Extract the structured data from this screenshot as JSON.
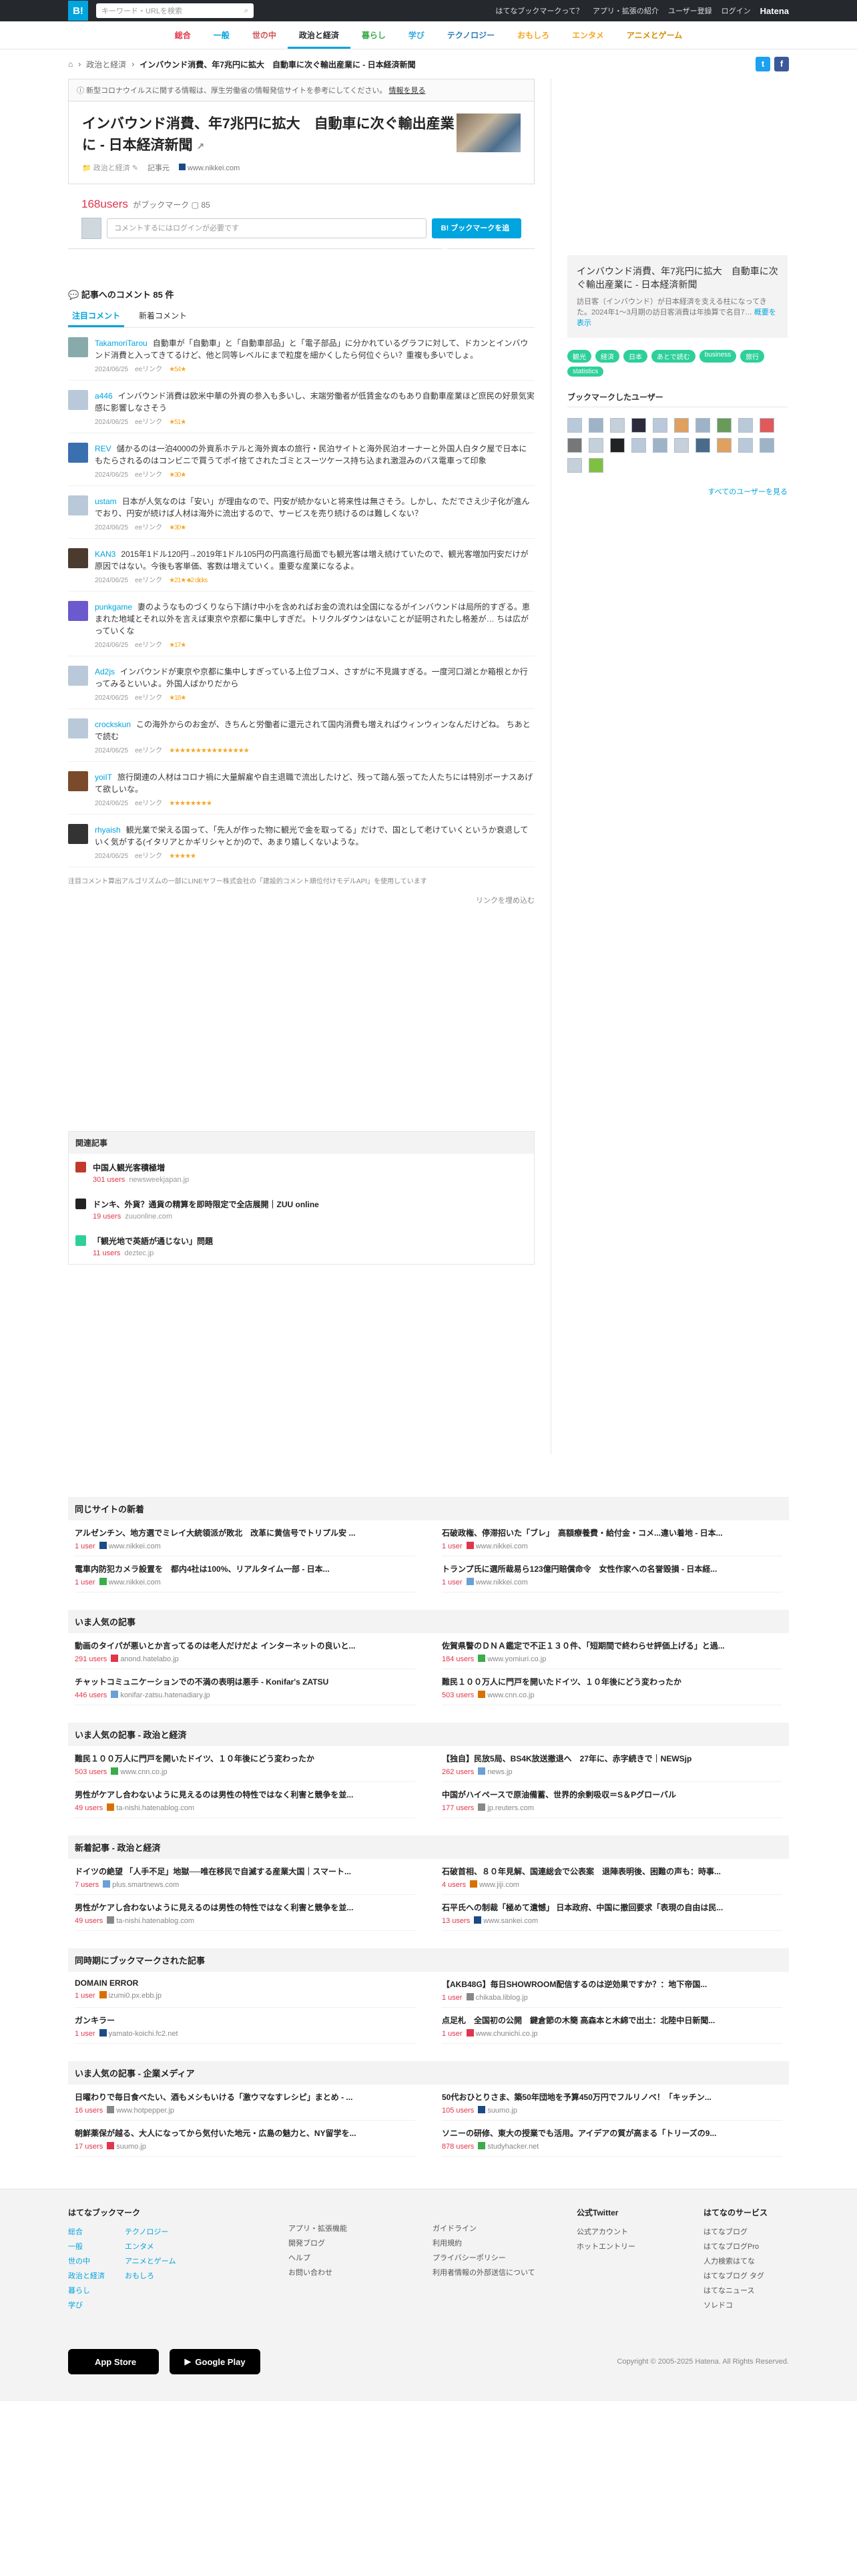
{
  "topbar": {
    "logo": "B!",
    "search_placeholder": "キーワード・URLを検索",
    "links": [
      "はてなブックマークって？",
      "アプリ・拡張の紹介",
      "ユーザー登録",
      "ログイン"
    ],
    "brand": "Hatena"
  },
  "nav": [
    "総合",
    "一般",
    "世の中",
    "政治と経済",
    "暮らし",
    "学び",
    "テクノロジー",
    "おもしろ",
    "エンタメ",
    "アニメとゲーム"
  ],
  "crumb": {
    "parent": "政治と経済",
    "current": "インバウンド消費、年7兆円に拡大　自動車に次ぐ輸出産業に - 日本経済新聞"
  },
  "notice": {
    "text": "新型コロナウイルスに関する情報は、厚生労働省の情報発信サイトを参考にしてください。",
    "link": "情報を見る"
  },
  "entry": {
    "title": "インバウンド消費、年7兆円に拡大　自動車に次ぐ輸出産業に - 日本経済新聞",
    "category": "政治と経済",
    "article_label": "記事元",
    "domain": "www.nikkei.com",
    "users": "168users",
    "bm_label": "がブックマーク",
    "comments_count": "85",
    "comment_placeholder": "コメントするにはログインが必要です",
    "add_button": "B! ブックマークを追加"
  },
  "comments_section": {
    "title": "記事へのコメント 85 件",
    "tab_popular": "注目コメント",
    "tab_new": "新着コメント"
  },
  "comments": [
    {
      "user": "TakamoriTarou",
      "text": "自動車が「自動車」と「自動車部品」と「電子部品」に分かれているグラフに対して、ドカンとインバウンド消費と入ってきてるけど、他と同等レベルにまで粒度を細かくしたら何位ぐらい？重複も多いでしょ。",
      "date": "2024/06/25",
      "link": "eeリンク",
      "stars": "★54★"
    },
    {
      "user": "a446",
      "text": "インバウンド消費は欧米中華の外資の参入も多いし、末端労働者が低賃金なのもあり自動車産業ほど庶民の好景気実感に影響しなさそう",
      "date": "2024/06/25",
      "link": "eeリンク",
      "stars": "★51★"
    },
    {
      "user": "REV",
      "text": "儲かるのは一泊4000の外資系ホテルと海外資本の旅行・民泊サイトと海外民泊オーナーと外国人白タク屋で日本にもたらされるのはコンビニで買うてポイ捨てされたゴミとスーツケース持ち込まれ激混みのバス電車って印象",
      "date": "2024/06/25",
      "link": "eeリンク",
      "stars": "★30★"
    },
    {
      "user": "ustam",
      "text": "日本が人気なのは「安い」が理由なので、円安が続かないと将来性は無さそう。しかし、ただでさえ少子化が進んでおり、円安が続けば人材は海外に流出するので、サービスを売り続けるのは難しくない？",
      "date": "2024/06/25",
      "link": "eeリンク",
      "stars": "★30★"
    },
    {
      "user": "KAN3",
      "text": "2015年1ドル120円→2019年1ドル105円の円高進行局面でも観光客は増え続けていたので、観光客増加円安だけが原因ではない。今後も客単価、客数は増えていく。重要な産業になるよ。",
      "date": "2024/06/25",
      "link": "eeリンク",
      "stars": "★21★  ♣2 clicks"
    },
    {
      "user": "punkgame",
      "text": "妻のようなものづくりなら下請け中小を含めればお金の流れは全国になるがインバウンドは局所的すぎる。恵まれた地域とそれ以外を言えば東京や京都に集中しすぎだ。トリクルダウンはないことが証明されたし格差が… ちは広がっていくな",
      "date": "2024/06/25",
      "link": "eeリンク",
      "stars": "★17★"
    },
    {
      "user": "Ad2js",
      "text": "インバウンドが東京や京都に集中しすぎっている上位ブコメ、さすがに不見識すぎる。一度河口湖とか箱根とか行ってみるといいよ。外国人ばかりだから",
      "date": "2024/06/25",
      "link": "eeリンク",
      "stars": "★18★"
    },
    {
      "user": "crockskun",
      "text": "この海外からのお金が、きちんと労働者に還元されて国内消費も増えればウィンウィンなんだけどね。 ちあとで読む",
      "date": "2024/06/25",
      "link": "eeリンク",
      "stars": "★★★★★★★★★★★★★★★"
    },
    {
      "user": "yoiIT",
      "text": "旅行関連の人材はコロナ禍に大量解雇や自主退職で流出したけど、残って踏ん張ってた人たちには特別ボーナスあげて欲しいな。",
      "date": "2024/06/25",
      "link": "eeリンク",
      "stars": "★★★★★★★★"
    },
    {
      "user": "rhyaish",
      "text": "観光業で栄える国って、「先人が作った物に観光で金を取ってる」だけで、国として老けていくというか衰退していく気がする(イタリアとかギリシャとか)ので、あまり嬉しくないような。",
      "date": "2024/06/25",
      "link": "eeリンク",
      "stars": "★★★★★"
    }
  ],
  "comment_note": "注目コメント算出アルゴリズムの一部にLINEヤフー株式会社の「建設的コメント順位付けモデルAPI」を使用しています",
  "embed_link": "リンクを埋め込む",
  "related": {
    "title": "関連記事",
    "items": [
      {
        "title": "中国人観光客積極増",
        "users": "301 users",
        "domain": "newsweekjapan.jp",
        "color": "#c0392b"
      },
      {
        "title": "ドンキ、外貨？通貨の精算を即時限定で全店展開｜ZUU online",
        "users": "19 users",
        "domain": "zuuonline.com",
        "color": "#222"
      },
      {
        "title": "「観光地で英語が通じない」問題",
        "users": "11 users",
        "domain": "deztec.jp",
        "color": "#2ecf9a"
      }
    ]
  },
  "sidebar": {
    "title": "インバウンド消費、年7兆円に拡大　自動車に次ぐ輸出産業に - 日本経済新聞",
    "desc": "訪日客（インバウンド）が日本経済を支える柱になってきた。2024年1～3月期の訪日客消費は年換算で名目7…",
    "more": "概要を表示",
    "tags": [
      "観光",
      "経済",
      "日本",
      "あとで読む",
      "business",
      "旅行",
      "statistics"
    ],
    "bm_users_title": "ブックマークしたユーザー",
    "all_users": "すべてのユーザーを見る"
  },
  "lists": [
    {
      "title": "同じサイトの新着",
      "items": [
        {
          "t": "アルゼンチン、地方選でミレイ大統領派が敗北　改革に黄信号でトリプル安 ...",
          "u": "1 user",
          "d": "www.nikkei.com"
        },
        {
          "t": "石破政権、停滞招いた「ブレ」　高額療養費・給付金・コメ...違い着地 - 日本...",
          "u": "1 user",
          "d": "www.nikkei.com"
        },
        {
          "t": "電車内防犯カメラ設置を　都内4社は100%、リアルタイム一部 - 日本...",
          "u": "1 user",
          "d": "www.nikkei.com"
        },
        {
          "t": "トランプ氏に選所裁易ら123億円賠償命令　女性作家への名誉毀損 - 日本経...",
          "u": "1 user",
          "d": "www.nikkei.com"
        }
      ]
    },
    {
      "title": "いま人気の記事",
      "items": [
        {
          "t": "動画のタイパが悪いとか言ってるのは老人だけだよ インターネットの良いと...",
          "u": "291 users",
          "d": "anond.hatelabo.jp"
        },
        {
          "t": "佐賀県警のＤＮＡ鑑定で不正１３０件、「短期間で終わらせ評価上げる」と過...",
          "u": "184 users",
          "d": "www.yomiuri.co.jp"
        },
        {
          "t": "チャットコミュニケーションでの不満の表明は悪手 - Konifar's ZATSU",
          "u": "446 users",
          "d": "konifar-zatsu.hatenadiary.jp"
        },
        {
          "t": "難民１００万人に門戸を開いたドイツ、１０年後にどう変わったか",
          "u": "503 users",
          "d": "www.cnn.co.jp"
        }
      ]
    },
    {
      "title": "いま人気の記事 - 政治と経済",
      "items": [
        {
          "t": "難民１００万人に門戸を開いたドイツ、１０年後にどう変わったか",
          "u": "503 users",
          "d": "www.cnn.co.jp"
        },
        {
          "t": "【独自】民放5局、BS4K放送撤退へ　27年に、赤字続きで｜NEWSjp",
          "u": "262 users",
          "d": "news.jp"
        },
        {
          "t": "男性がケアし合わないように見えるのは男性の特性ではなく利害と競争を並...",
          "u": "49 users",
          "d": "ta-nishi.hatenablog.com"
        },
        {
          "t": "中国がハイペースで原油備蓄、世界的余剰吸収＝S＆Pグローバル",
          "u": "177 users",
          "d": "jp.reuters.com"
        }
      ]
    },
    {
      "title": "新着記事 - 政治と経済",
      "items": [
        {
          "t": "ドイツの絶望 「人手不足」地獄──唯在移民で自滅する産業大国｜スマート...",
          "u": "7 users",
          "d": "plus.smartnews.com"
        },
        {
          "t": "石破首相、８０年見解、国連総会で公表案　退陣表明後、困難の声も：時事...",
          "u": "4 users",
          "d": "www.jiji.com"
        },
        {
          "t": "男性がケアし合わないように見えるのは男性の特性ではなく利害と競争を並...",
          "u": "49 users",
          "d": "ta-nishi.hatenablog.com"
        },
        {
          "t": "石平氏への制裁「極めて遺憾」 日本政府、中国に撤回要求「表現の自由は民...",
          "u": "13 users",
          "d": "www.sankei.com"
        }
      ]
    },
    {
      "title": "同時期にブックマークされた記事",
      "items": [
        {
          "t": "DOMAIN ERROR",
          "u": "1 user",
          "d": "izumi0.px.ebb.jp"
        },
        {
          "t": "【AKB48G】毎日SHOWROOM配信するのは逆効果ですか？：地下帝国...",
          "u": "1 user",
          "d": "chikaba.liblog.jp"
        },
        {
          "t": "ガンキラー",
          "u": "1 user",
          "d": "yamato-koichi.fc2.net"
        },
        {
          "t": "点足札　全国初の公開　鍵倉節の木簡 高森本と木綿で出土：北陸中日新聞...",
          "u": "1 user",
          "d": "www.chunichi.co.jp"
        }
      ]
    },
    {
      "title": "いま人気の記事 - 企業メディア",
      "items": [
        {
          "t": "日曜わりで毎日食べたい、酒もメシもいける「激ウマなすレシピ」まとめ - ...",
          "u": "16 users",
          "d": "www.hotpepper.jp"
        },
        {
          "t": "50代おひとりさま、築50年団地を予算450万円でフルリノベ！「キッチン...",
          "u": "105 users",
          "d": "suumo.jp"
        },
        {
          "t": "朝鮮薬保が越る、大人になってから気付いた地元・広島の魅力と、NY留学を...",
          "u": "17 users",
          "d": "suumo.jp"
        },
        {
          "t": "ソニーの研修、東大の授業でも活用。アイデアの質が高まる「トリーズの9...",
          "u": "878 users",
          "d": "studyhacker.net"
        }
      ]
    }
  ],
  "footer": {
    "col1_title": "はてなブックマーク",
    "col1a": [
      "総合",
      "一般",
      "世の中",
      "政治と経済",
      "暮らし",
      "学び"
    ],
    "col1b": [
      "テクノロジー",
      "エンタメ",
      "アニメとゲーム",
      "おもしろ"
    ],
    "col2": [
      "アプリ・拡張機能",
      "開発ブログ",
      "ヘルプ",
      "お問い合わせ"
    ],
    "col3": [
      "ガイドライン",
      "利用規約",
      "プライバシーポリシー",
      "利用者情報の外部送信について"
    ],
    "col4_title": "公式Twitter",
    "col4": [
      "公式アカウント",
      "ホットエントリー"
    ],
    "col5_title": "はてなのサービス",
    "col5": [
      "はてなブログ",
      "はてなブログPro",
      "人力検索はてな",
      "はてなブログ タグ",
      "はてなニュース",
      "ソレドコ"
    ],
    "appstore": "App Store",
    "googleplay": "Google Play",
    "copyright": "Copyright © 2005-2025 Hatena. All Rights Reserved."
  }
}
